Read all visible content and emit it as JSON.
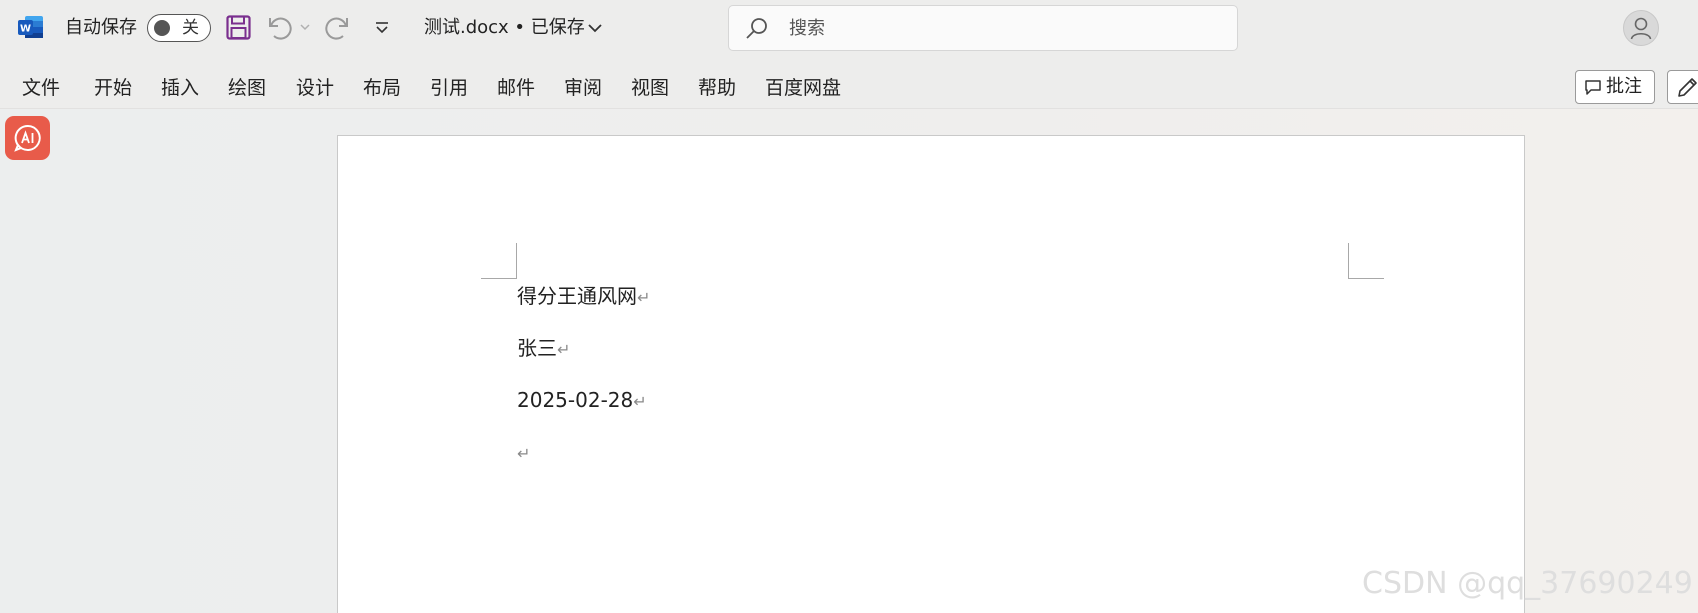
{
  "titlebar": {
    "autosave_label": "自动保存",
    "autosave_state": "关",
    "doc_title": "测试.docx • 已保存",
    "search_placeholder": "搜索"
  },
  "ribbon": {
    "tabs": [
      "文件",
      "开始",
      "插入",
      "绘图",
      "设计",
      "布局",
      "引用",
      "邮件",
      "审阅",
      "视图",
      "帮助",
      "百度网盘"
    ],
    "comment_label": "批注"
  },
  "document": {
    "lines": [
      "得分王通风网",
      "张三",
      "2025-02-28",
      ""
    ],
    "paragraph_mark": "↵"
  },
  "watermark": "CSDN @qq_37690249",
  "colors": {
    "word_blue": "#185abd",
    "save_purple": "#7a2f8e",
    "ai_red": "#e85b4a"
  },
  "icons": [
    "word-logo-icon",
    "save-icon",
    "undo-icon",
    "redo-icon",
    "customize-qat-icon",
    "search-icon",
    "avatar-icon",
    "comment-icon",
    "pencil-icon",
    "ai-assistant-icon"
  ]
}
